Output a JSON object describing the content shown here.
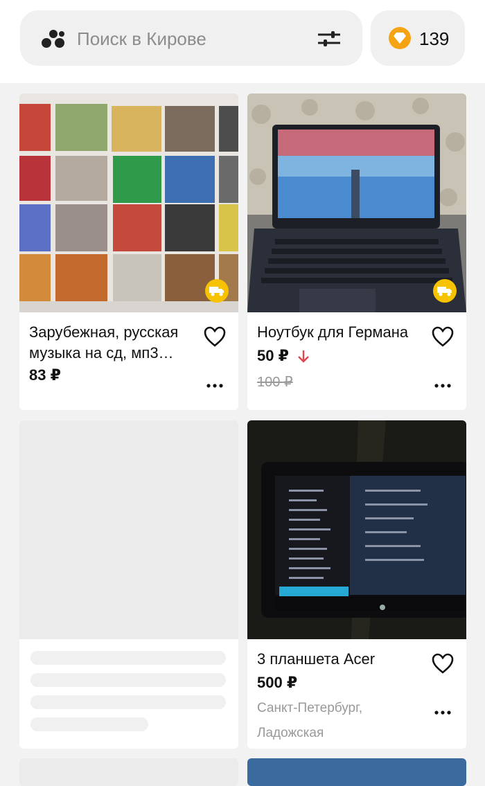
{
  "search": {
    "placeholder": "Поиск в Кирове"
  },
  "wallet": {
    "count": "139",
    "accent": "#f5a312"
  },
  "listings": [
    {
      "title": "Зарубежная, русская музыка на сд, мп3…",
      "price": "83 ₽",
      "delivery": true
    },
    {
      "title": "Ноутбук для Германа",
      "price": "50 ₽",
      "old_price": "100 ₽",
      "price_drop": true,
      "delivery": true
    },
    {
      "loading": true
    },
    {
      "title": "3 планшета Acer",
      "price": "500 ₽",
      "location_line1": "Санкт-Петербург,",
      "location_line2": "Ладожская"
    }
  ],
  "colors": {
    "price_drop": "#e0464d",
    "delivery_badge": "#f7c300"
  }
}
